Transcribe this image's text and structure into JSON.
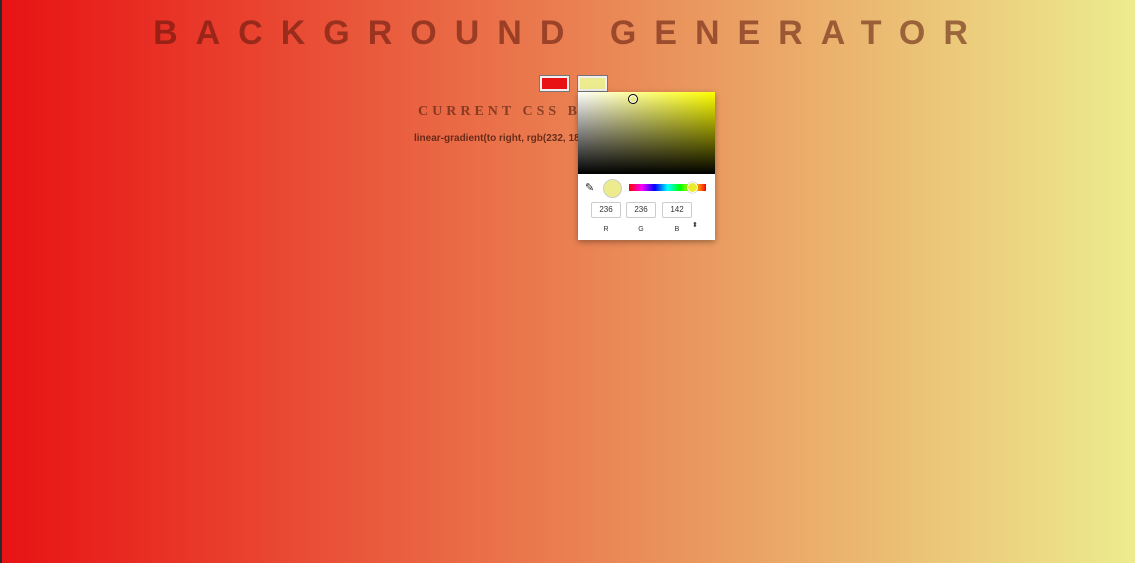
{
  "header": {
    "title": "BACKGROUND GENERATOR"
  },
  "colors": {
    "color1": "#e81214",
    "color2": "#ecec8e"
  },
  "current_css": {
    "heading": "CURRENT CSS BACKGROUND",
    "value": "linear-gradient(to right, rgb(232, 18, 20), rgb(236, 236, 142));"
  },
  "picker": {
    "r": "236",
    "g": "236",
    "b": "142",
    "label_r": "R",
    "label_g": "G",
    "label_b": "B",
    "format_toggle": "⬍"
  },
  "icons": {
    "eyedropper": "eyedropper-icon"
  }
}
